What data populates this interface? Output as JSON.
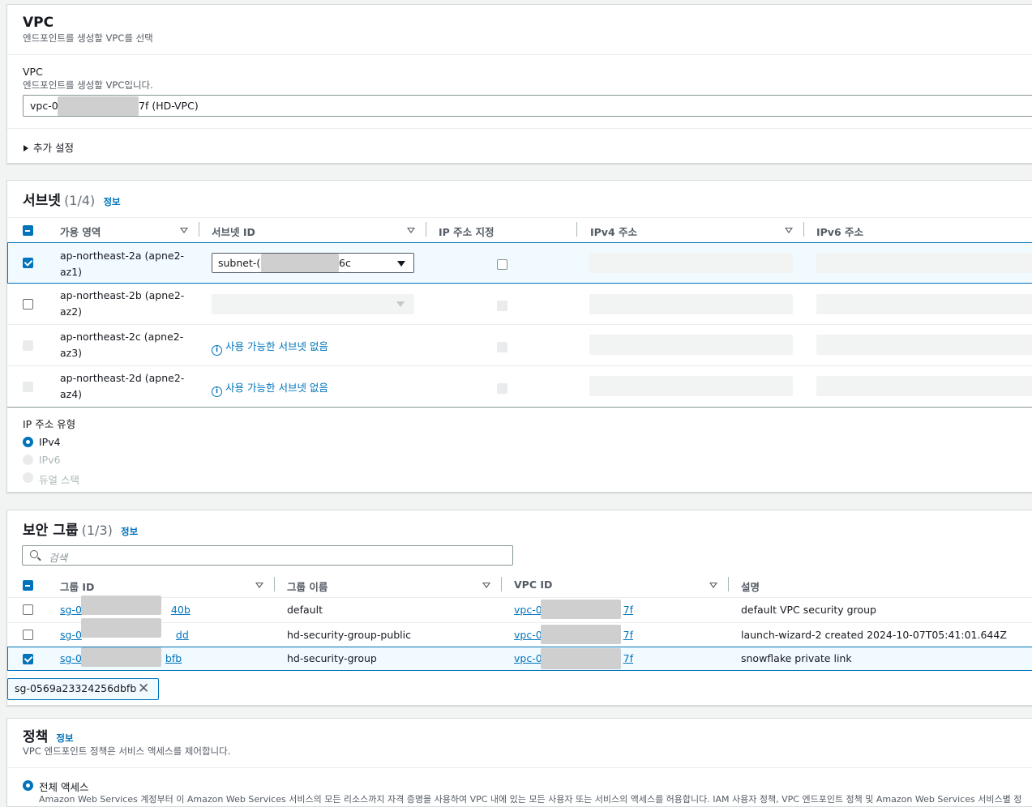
{
  "vpc_section": {
    "title": "VPC",
    "description": "엔드포인트를 생성할 VPC를 선택",
    "field_label": "VPC",
    "field_description": "엔드포인트를 생성할 VPC입니다.",
    "field_value_prefix": "vpc-0",
    "field_value_suffix": "7f (HD-VPC)",
    "additional_settings": "추가 설정"
  },
  "subnets": {
    "title": "서브넷",
    "count": "(1/4)",
    "info": "정보",
    "columns": [
      "가용 영역",
      "서브넷 ID",
      "IP 주소 지정",
      "IPv4 주소",
      "IPv6 주소"
    ],
    "rows": [
      {
        "az": "ap-northeast-2a (apne2-",
        "az2": "az1)",
        "checked": true,
        "subnet_prefix": "subnet-(",
        "subnet_suffix": "6c"
      },
      {
        "az": "ap-northeast-2b (apne2-",
        "az2": "az2)",
        "checked": false
      },
      {
        "az": "ap-northeast-2c (apne2-",
        "az2": "az3)",
        "checked": false,
        "no_subnet": "사용 가능한 서브넷 없음"
      },
      {
        "az": "ap-northeast-2d (apne2-",
        "az2": "az4)",
        "checked": false,
        "no_subnet": "사용 가능한 서브넷 없음"
      }
    ],
    "ip_type_label": "IP 주소 유형",
    "ip_options": [
      "IPv4",
      "IPv6",
      "듀얼 스택"
    ]
  },
  "security_groups": {
    "title": "보안 그룹",
    "count": "(1/3)",
    "info": "정보",
    "search_placeholder": "검색",
    "columns": [
      "그룹 ID",
      "그룹 이름",
      "VPC ID",
      "설명"
    ],
    "rows": [
      {
        "id_prefix": "sg-0",
        "id_suffix": "40b",
        "name": "default",
        "vpc_prefix": "vpc-0",
        "vpc_suffix": "7f",
        "desc": "default VPC security group",
        "checked": false
      },
      {
        "id_prefix": "sg-0",
        "id_suffix": "dd",
        "name": "hd-security-group-public",
        "vpc_prefix": "vpc-0",
        "vpc_suffix": "7f",
        "desc": "launch-wizard-2 created 2024-10-07T05:41:01.644Z",
        "checked": false
      },
      {
        "id_prefix": "sg-0",
        "id_suffix": "bfb",
        "name": "hd-security-group",
        "vpc_prefix": "vpc-0",
        "vpc_suffix": "7f",
        "desc": "snowflake private link",
        "checked": true
      }
    ],
    "token": "sg-0569a23324256dbfb"
  },
  "policy": {
    "title": "정책",
    "info": "정보",
    "description": "VPC 엔드포인트 정책은 서비스 액세스를 제어합니다.",
    "option_label": "전체 액세스",
    "option_desc": "Amazon Web Services 계정부터 이 Amazon Web Services 서비스의 모든 리소스까지 자격 증명을 사용하여 VPC 내에 있는 모든 사용자 또는 서비스의 액세스를 허용합니다. IAM 사용자 정책, VPC 엔드포인트 정책 및 Amazon Web Services 서비스별 정"
  },
  "colors": {
    "accent": "#0073bb",
    "redact": "#cfcfcf"
  }
}
